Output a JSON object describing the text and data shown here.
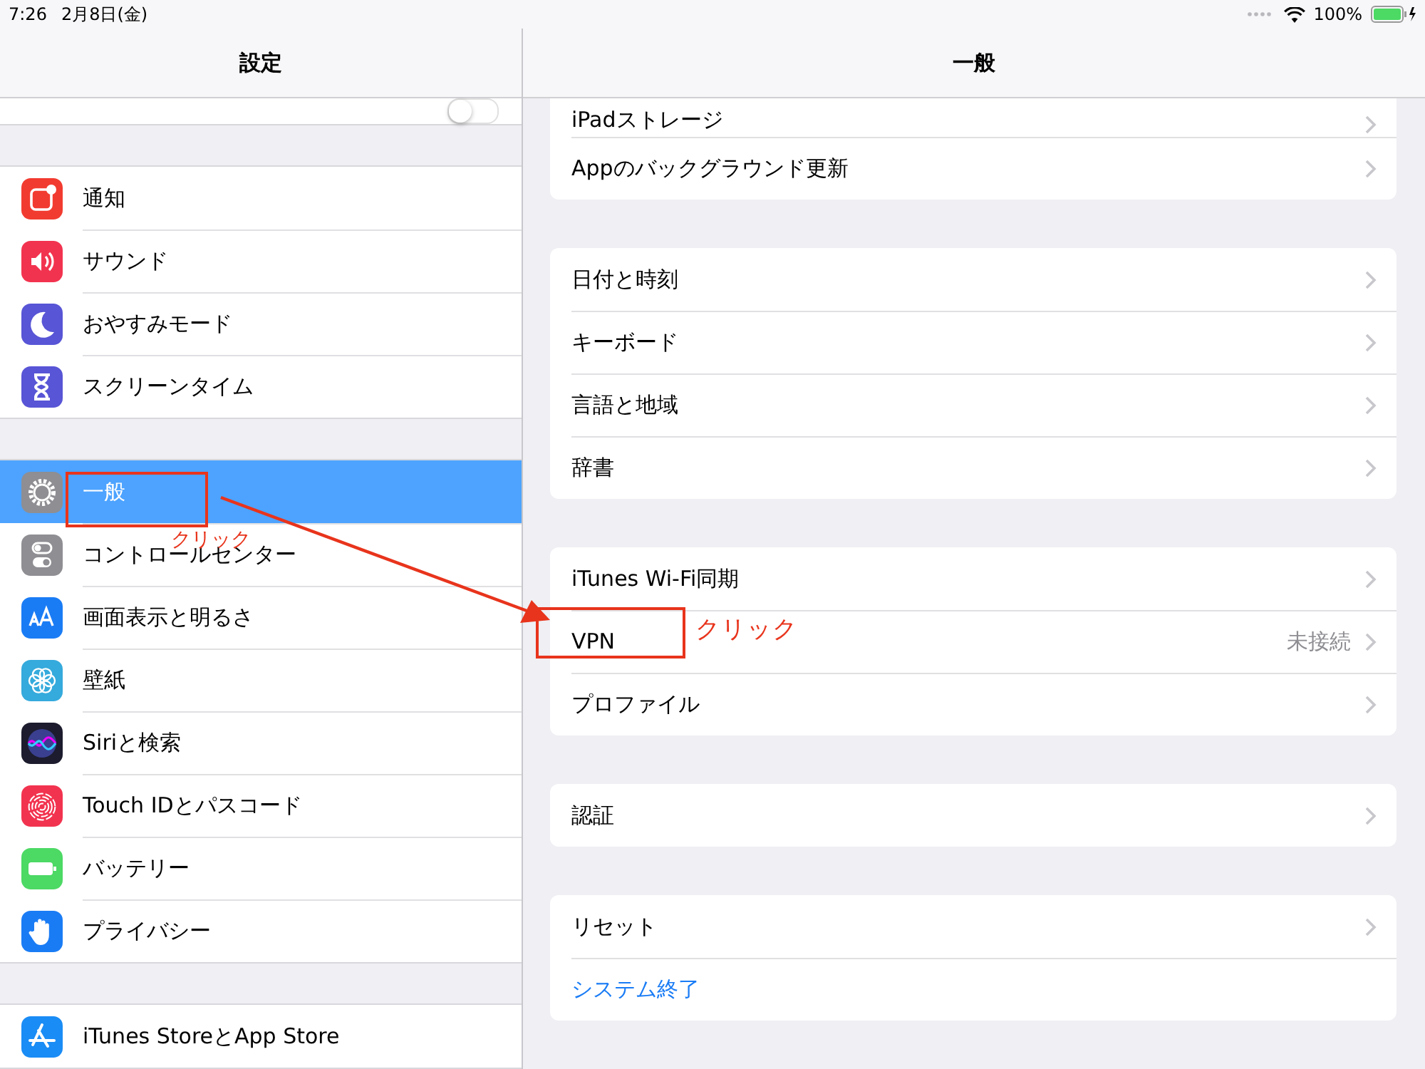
{
  "status_bar": {
    "time": "7:26",
    "date": "2月8日(金)",
    "battery": "100%"
  },
  "sidebar": {
    "title": "設定",
    "top_toggle_on": false,
    "groups": [
      [
        {
          "label": "通知",
          "kind": "notification",
          "color": "#f23b30",
          "selected": false
        },
        {
          "label": "サウンド",
          "kind": "sound",
          "color": "#f2334f",
          "selected": false
        },
        {
          "label": "おやすみモード",
          "kind": "moon",
          "color": "#5855d6",
          "selected": false
        },
        {
          "label": "スクリーンタイム",
          "kind": "hourglass",
          "color": "#5855d6",
          "selected": false
        }
      ],
      [
        {
          "label": "一般",
          "kind": "gear",
          "color": "#8e8e93",
          "selected": true
        },
        {
          "label": "コントロールセンター",
          "kind": "switches",
          "color": "#8e8e93",
          "selected": false
        },
        {
          "label": "画面表示と明るさ",
          "kind": "textsize",
          "color": "#1a7cf5",
          "selected": false
        },
        {
          "label": "壁紙",
          "kind": "flower",
          "color": "#35aadc",
          "selected": false
        },
        {
          "label": "Siriと検索",
          "kind": "siri",
          "color": "#1c1c2e",
          "selected": false
        },
        {
          "label": "Touch IDとパスコード",
          "kind": "fingerprint",
          "color": "#f2334f",
          "selected": false
        },
        {
          "label": "バッテリー",
          "kind": "battery",
          "color": "#4cd964",
          "selected": false
        },
        {
          "label": "プライバシー",
          "kind": "hand",
          "color": "#1a7cf5",
          "selected": false
        }
      ],
      [
        {
          "label": "iTunes StoreとApp Store",
          "kind": "appstore",
          "color": "#1a8cf5",
          "selected": false
        }
      ]
    ]
  },
  "detail": {
    "title": "一般",
    "groups": [
      [
        {
          "label": "iPadストレージ",
          "kind": "cut"
        },
        {
          "label": "Appのバックグラウンド更新",
          "kind": "nav"
        }
      ],
      [
        {
          "label": "日付と時刻",
          "kind": "nav"
        },
        {
          "label": "キーボード",
          "kind": "nav"
        },
        {
          "label": "言語と地域",
          "kind": "nav"
        },
        {
          "label": "辞書",
          "kind": "nav"
        }
      ],
      [
        {
          "label": "iTunes Wi-Fi同期",
          "kind": "nav"
        },
        {
          "label": "VPN",
          "kind": "nav",
          "value": "未接続"
        },
        {
          "label": "プロファイル",
          "kind": "nav"
        }
      ],
      [
        {
          "label": "認証",
          "kind": "nav"
        }
      ],
      [
        {
          "label": "リセット",
          "kind": "nav"
        },
        {
          "label": "システム終了",
          "kind": "action"
        }
      ]
    ]
  },
  "annotations": [
    "クリック",
    "クリック"
  ]
}
